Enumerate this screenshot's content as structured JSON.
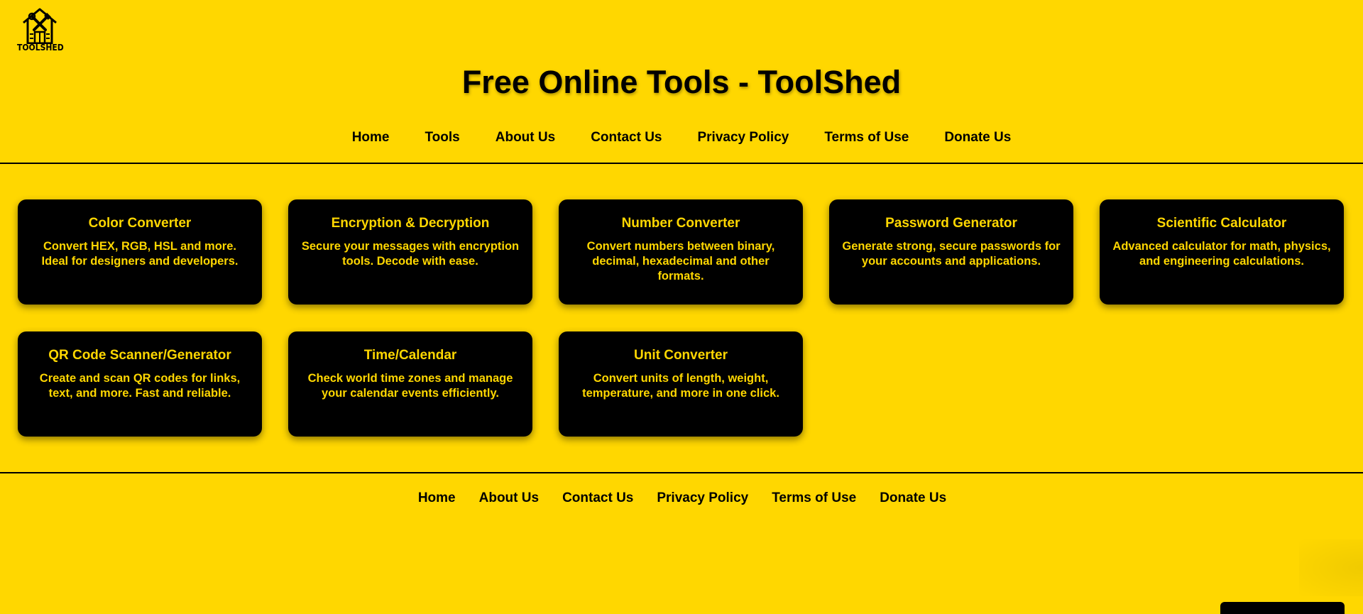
{
  "logo": {
    "icon": "toolshed-house-icon",
    "text": "TOOLSHED"
  },
  "header": {
    "title": "Free Online Tools - ToolShed"
  },
  "top_nav": [
    {
      "label": "Home"
    },
    {
      "label": "Tools"
    },
    {
      "label": "About Us"
    },
    {
      "label": "Contact Us"
    },
    {
      "label": "Privacy Policy"
    },
    {
      "label": "Terms of Use"
    },
    {
      "label": "Donate Us"
    }
  ],
  "tools": [
    {
      "title": "Color Converter",
      "description": "Convert HEX, RGB, HSL and more. Ideal for designers and developers."
    },
    {
      "title": "Encryption & Decryption",
      "description": "Secure your messages with encryption tools. Decode with ease."
    },
    {
      "title": "Number Converter",
      "description": "Convert numbers between binary, decimal, hexadecimal and other formats."
    },
    {
      "title": "Password Generator",
      "description": "Generate strong, secure passwords for your accounts and applications."
    },
    {
      "title": "Scientific Calculator",
      "description": "Advanced calculator for math, physics, and engineering calculations."
    },
    {
      "title": "QR Code Scanner/Generator",
      "description": "Create and scan QR codes for links, text, and more. Fast and reliable."
    },
    {
      "title": "Time/Calendar",
      "description": "Check world time zones and manage your calendar events efficiently."
    },
    {
      "title": "Unit Converter",
      "description": "Convert units of length, weight, temperature, and more in one click."
    }
  ],
  "footer_nav": [
    {
      "label": "Home"
    },
    {
      "label": "About Us"
    },
    {
      "label": "Contact Us"
    },
    {
      "label": "Privacy Policy"
    },
    {
      "label": "Terms of Use"
    },
    {
      "label": "Donate Us"
    }
  ],
  "colors": {
    "background": "#FFD700",
    "card": "#000000",
    "card_text": "#FFD700",
    "text": "#000000"
  }
}
